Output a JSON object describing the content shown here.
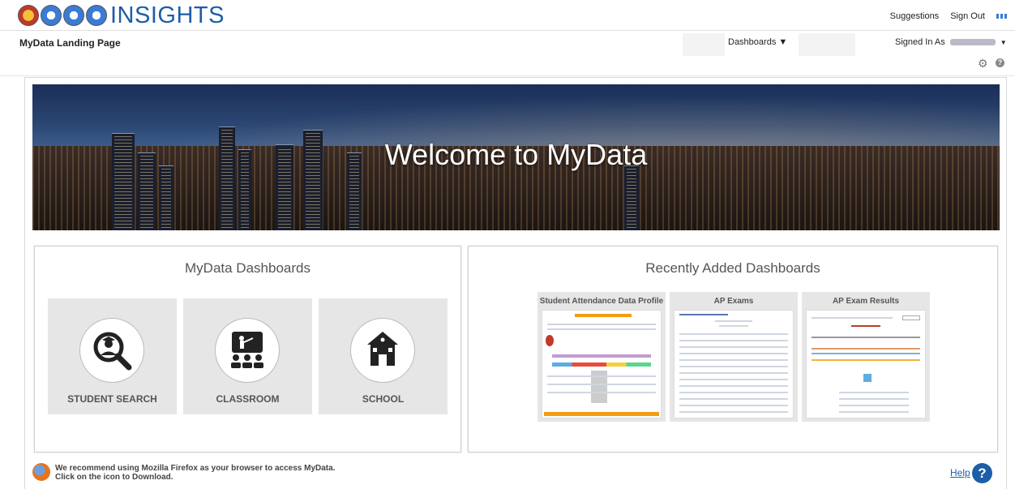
{
  "brand": {
    "name": "INSIGHTS"
  },
  "top_links": {
    "suggestions": "Suggestions",
    "sign_out": "Sign Out"
  },
  "subheader": {
    "page_title": "MyData Landing Page",
    "dashboards_menu": "Dashboards ▼",
    "signed_in_label": "Signed In As",
    "user_caret": "▼"
  },
  "hero": {
    "title": "Welcome to MyData"
  },
  "left_panel": {
    "title": "MyData Dashboards",
    "tiles": [
      {
        "label": "STUDENT SEARCH",
        "icon": "student-search-icon"
      },
      {
        "label": "CLASSROOM",
        "icon": "classroom-icon"
      },
      {
        "label": "SCHOOL",
        "icon": "school-icon"
      }
    ]
  },
  "right_panel": {
    "title": "Recently Added Dashboards",
    "thumbnails": [
      {
        "title": "Student Attendance Data Profile"
      },
      {
        "title": "AP Exams"
      },
      {
        "title": "AP Exam Results"
      }
    ]
  },
  "footer": {
    "firefox_line1": "We recommend using Mozilla Firefox as your browser to access MyData.",
    "firefox_line2": "Click on the icon to Download.",
    "help": "Help",
    "help_symbol": "?"
  },
  "colors": {
    "brand_blue": "#1d5ea8",
    "tile_bg": "#e6e6e6"
  }
}
